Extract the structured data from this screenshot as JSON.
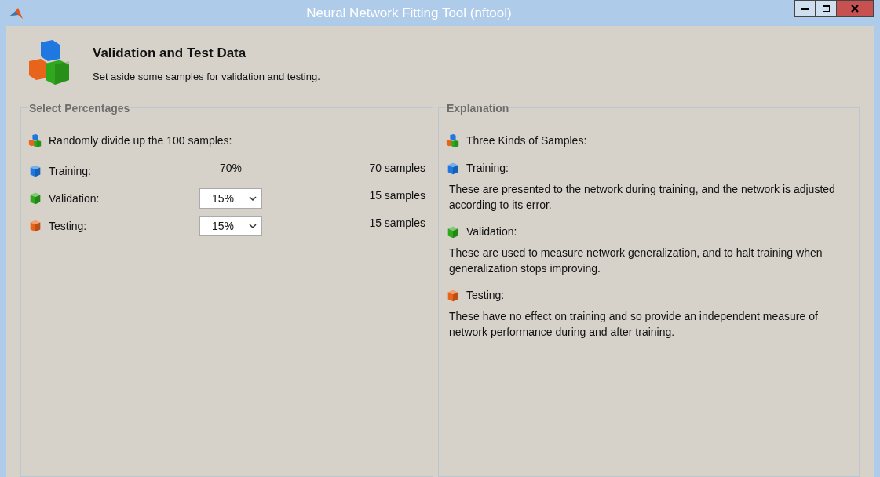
{
  "window": {
    "title": "Neural Network Fitting Tool (nftool)"
  },
  "header": {
    "title": "Validation and Test Data",
    "subtitle": "Set aside some samples for validation and testing."
  },
  "select_panel": {
    "title": "Select Percentages",
    "intro": "Randomly divide up the 100 samples:",
    "rows": [
      {
        "label": "Training:",
        "kind": "fixed",
        "value": "70%",
        "samples": "70 samples",
        "color": "#1e78e0"
      },
      {
        "label": "Validation:",
        "kind": "dropdown",
        "value": "15%",
        "samples": "15 samples",
        "color": "#2fa81e"
      },
      {
        "label": "Testing:",
        "kind": "dropdown",
        "value": "15%",
        "samples": "15 samples",
        "color": "#e8641a"
      }
    ]
  },
  "explanation_panel": {
    "title": "Explanation",
    "intro": "Three Kinds of Samples:",
    "items": [
      {
        "label": "Training:",
        "text": "These are presented to the network during training, and the network is adjusted according to its error.",
        "color": "#1e78e0"
      },
      {
        "label": "Validation:",
        "text": "These are used to measure network generalization, and to halt training when generalization stops improving.",
        "color": "#2fa81e"
      },
      {
        "label": "Testing:",
        "text": "These have no effect on training and so provide an independent measure of network performance during and after training.",
        "color": "#e8641a"
      }
    ]
  }
}
